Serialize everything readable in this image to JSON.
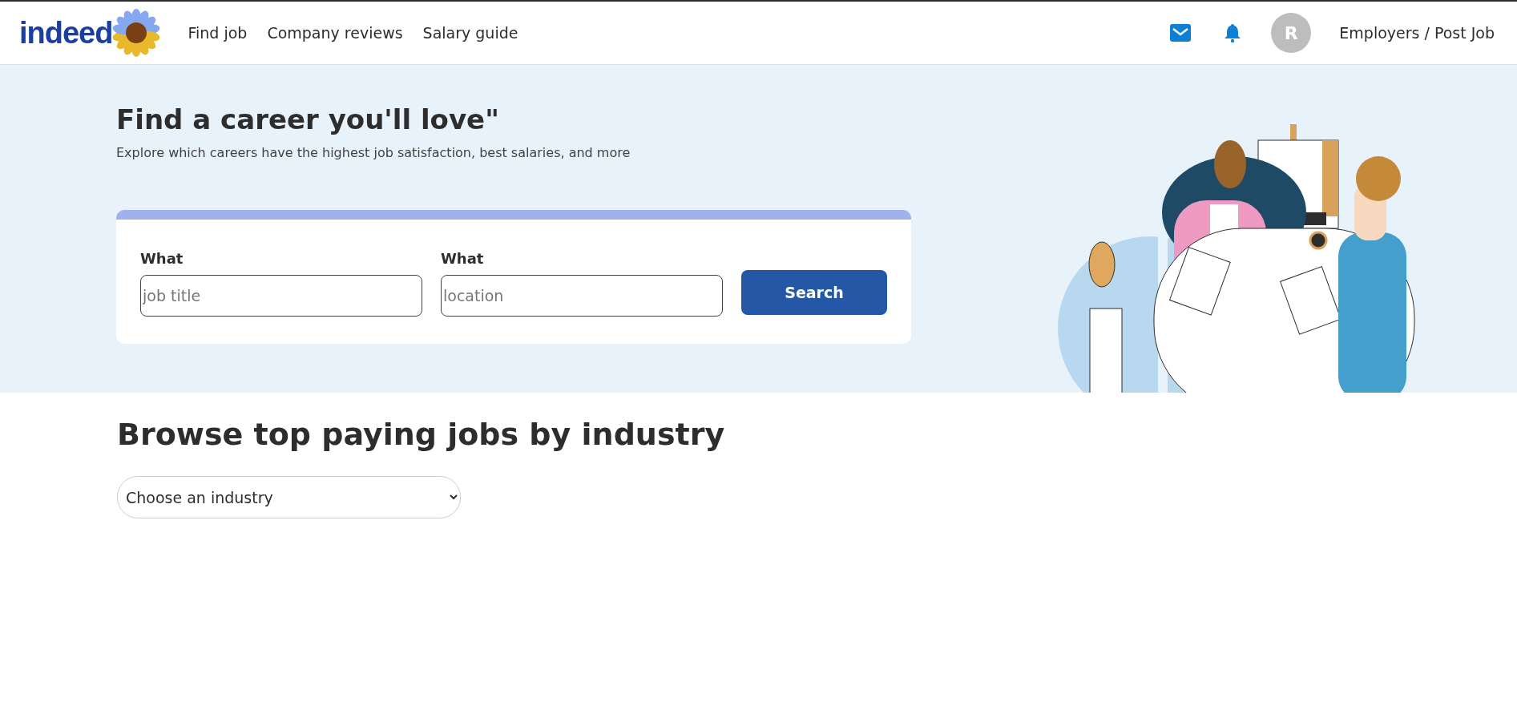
{
  "header": {
    "logo": "indeed",
    "nav": [
      "Find job",
      "Company reviews",
      "Salary guide"
    ],
    "avatar": "R",
    "employers_link": "Employers / Post Job"
  },
  "hero": {
    "title": "Find a career you'll love\"",
    "subtitle": "Explore which careers have the highest job satisfaction, best salaries, and more",
    "search": {
      "fields": [
        {
          "label": "What",
          "placeholder": "job title"
        },
        {
          "label": "What",
          "placeholder": "location"
        }
      ],
      "button": "Search"
    }
  },
  "browse": {
    "title": "Browse top paying jobs by industry",
    "select": {
      "value": "Choose an industry"
    }
  }
}
